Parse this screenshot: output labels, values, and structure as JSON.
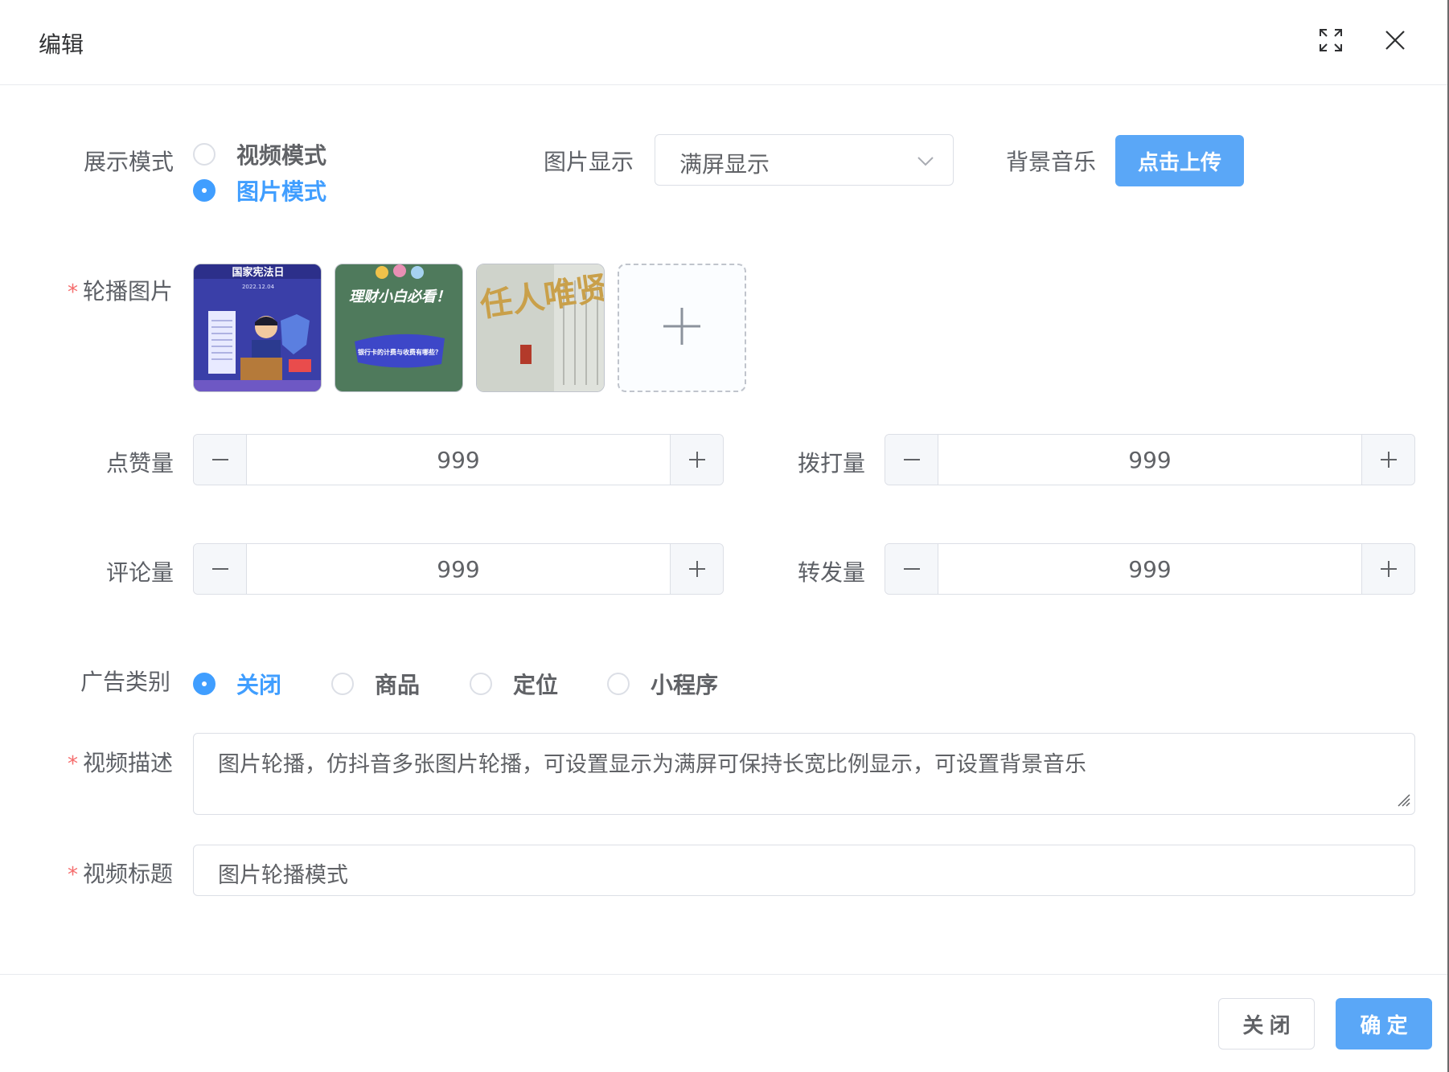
{
  "dialog": {
    "title": "编辑"
  },
  "display_mode": {
    "label": "展示模式",
    "options": [
      "视频模式",
      "图片模式"
    ],
    "selected": "图片模式"
  },
  "image_display": {
    "label": "图片显示",
    "value": "满屏显示"
  },
  "bg_music": {
    "label": "背景音乐",
    "button": "点击上传"
  },
  "carousel": {
    "label": "轮播图片",
    "images": [
      {
        "text_top": "国家宪法日",
        "text_sub": "2022.12.04"
      },
      {
        "text_top": "理财小白必看！",
        "text_sub": "银行卡的计费与收费有哪些？"
      },
      {
        "text_top": "任人唯贤"
      }
    ]
  },
  "stats": {
    "likes": {
      "label": "点赞量",
      "value": "999"
    },
    "calls": {
      "label": "拨打量",
      "value": "999"
    },
    "comments": {
      "label": "评论量",
      "value": "999"
    },
    "shares": {
      "label": "转发量",
      "value": "999"
    }
  },
  "ad_type": {
    "label": "广告类别",
    "options": [
      "关闭",
      "商品",
      "定位",
      "小程序"
    ],
    "selected": "关闭"
  },
  "video_desc": {
    "label": "视频描述",
    "value": "图片轮播，仿抖音多张图片轮播，可设置显示为满屏可保持长宽比例显示，可设置背景音乐"
  },
  "video_title": {
    "label": "视频标题",
    "value": "图片轮播模式"
  },
  "footer": {
    "close": "关 闭",
    "confirm": "确 定"
  },
  "colors": {
    "primary": "#409eff",
    "required": "#f56c6c"
  },
  "icons": [
    "fullscreen-icon",
    "close-icon",
    "chevron-down-icon",
    "plus-icon",
    "minus-icon",
    "resize-grip-icon"
  ]
}
